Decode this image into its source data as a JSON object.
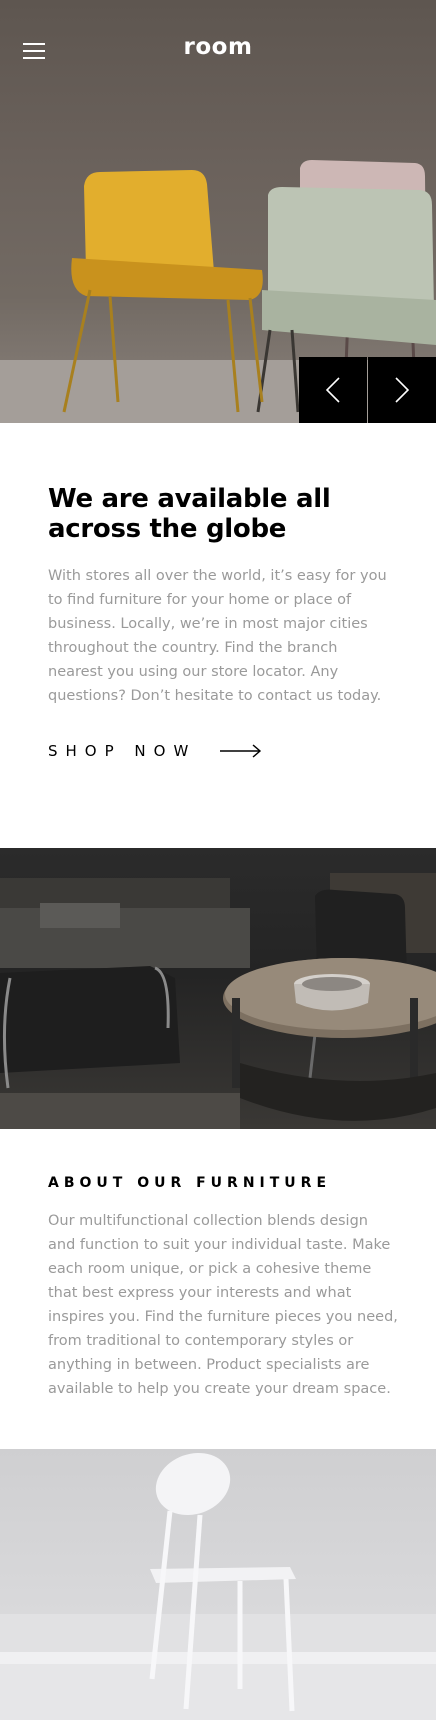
{
  "header": {
    "logo": "room",
    "menu_icon": "hamburger-menu-icon"
  },
  "hero": {
    "image": "yellow-green-pink-chairs-photo",
    "prev_icon": "chevron-left-icon",
    "next_icon": "chevron-right-icon"
  },
  "availability": {
    "title": "We are available all across the globe",
    "body": "With stores all over the world, it’s easy for you to find furniture for your home or place of business. Locally, we’re in most major cities throughout the country. Find the branch nearest you using our store locator. Any questions? Don’t hesitate to contact us today.",
    "cta_label": "SHOP NOW",
    "cta_icon": "arrow-right-icon"
  },
  "dark_image": "dark-living-room-photo",
  "about": {
    "title": "ABOUT OUR FURNITURE",
    "body": "Our multifunctional collection blends design and function to suit your individual taste. Make each room unique, or pick a cohesive theme that best express your interests and what inspires you. Find the furniture pieces you need, from traditional to contemporary styles or anything in between. Product specialists are available to help you create your dream space."
  },
  "light_image": "white-chair-photo"
}
